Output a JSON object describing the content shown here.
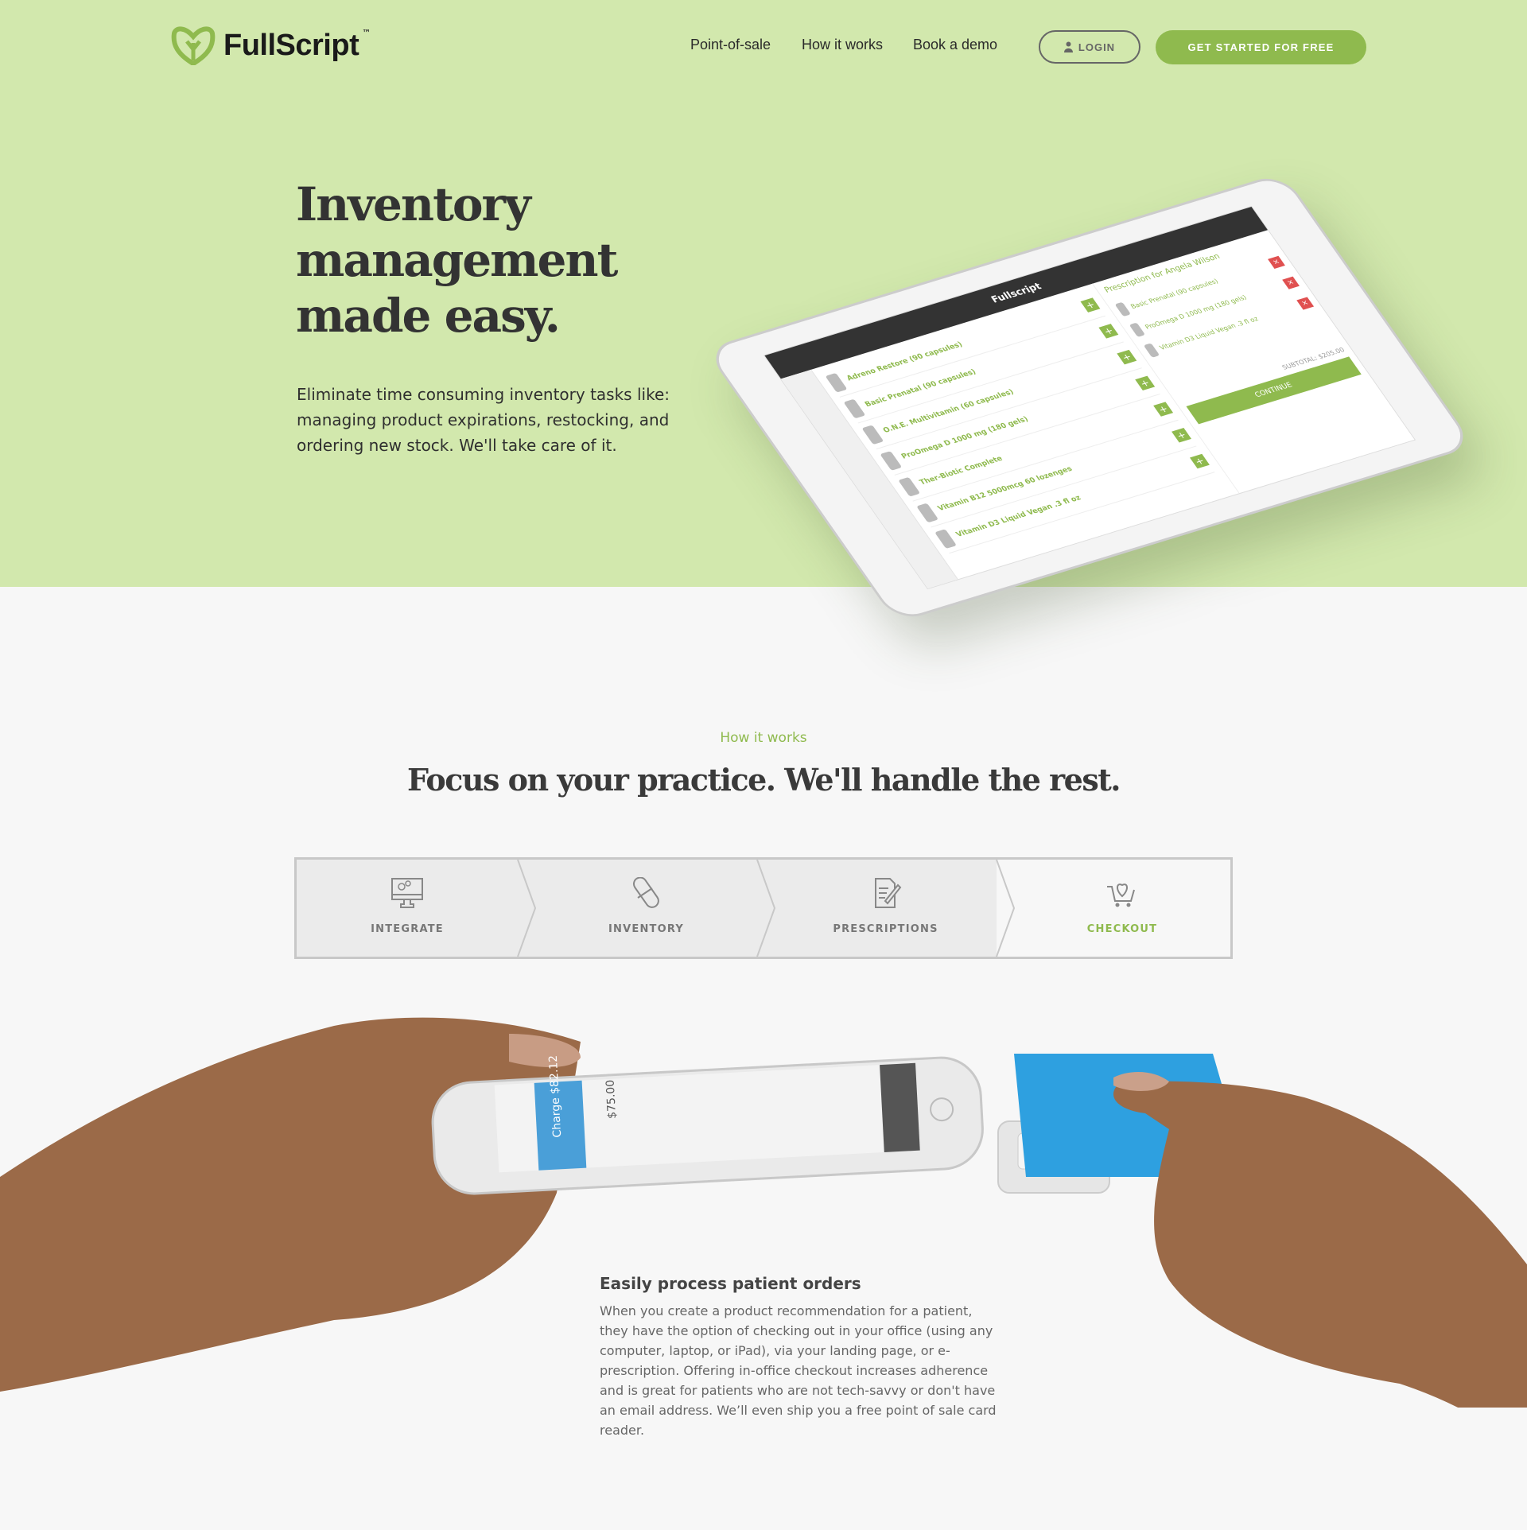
{
  "header": {
    "logo_text": "FullScript",
    "logo_tm": "™",
    "nav": [
      "Point-of-sale",
      "How it works",
      "Book a demo"
    ],
    "login_label": "LOGIN",
    "cta_label": "GET STARTED FOR FREE"
  },
  "hero": {
    "headline_lines": [
      "Inventory",
      "management",
      "made easy."
    ],
    "lead": "Eliminate time consuming inventory tasks like: managing product expirations, restocking, and ordering new stock. We'll take care of it.",
    "ipad": {
      "brand": "Fullscript",
      "products": [
        "Adreno Restore (90 capsules)",
        "Basic Prenatal (90 capsules)",
        "O.N.E. Multivitamin (60 capsules)",
        "ProOmega D 1000 mg (180 gels)",
        "Ther-Biotic Complete",
        "Vitamin B12 5000mcg 60 lozenges",
        "Vitamin D3 Liquid Vegan .3 fl oz"
      ],
      "rx_title": "Prescription for Angela Wilson",
      "rx_items": [
        "Basic Prenatal (90 capsules)",
        "ProOmega D 1000 mg (180 gels)",
        "Vitamin D3 Liquid Vegan .3 fl oz"
      ],
      "subtotal": "SUBTOTAL: $205.00",
      "continue": "CONTINUE"
    }
  },
  "how_it_works": {
    "label": "How it works",
    "title": "Focus on your practice. We'll handle the rest.",
    "tabs": [
      {
        "label": "INTEGRATE",
        "icon": "monitor-gears-icon",
        "active": false
      },
      {
        "label": "INVENTORY",
        "icon": "pill-icon",
        "active": false
      },
      {
        "label": "PRESCRIPTIONS",
        "icon": "document-pen-icon",
        "active": false
      },
      {
        "label": "CHECKOUT",
        "icon": "cart-heart-icon",
        "active": true
      }
    ]
  },
  "phone": {
    "charge": "Charge $82.12",
    "amount": "$75.00"
  },
  "feature": {
    "title": "Easily process patient orders",
    "body": "When you create a product recommendation for a patient, they have the option of checking out in your office (using any computer, laptop, or iPad), via your landing page, or e-prescription. Offering in-office checkout increases adherence and is great for patients who are not tech-savvy or don't have an email address. We’ll even ship you a free point of sale card reader."
  },
  "colors": {
    "brand_green": "#8fba4e",
    "hero_bg": "#d2e8ad",
    "page_bg": "#f7f7f7"
  }
}
